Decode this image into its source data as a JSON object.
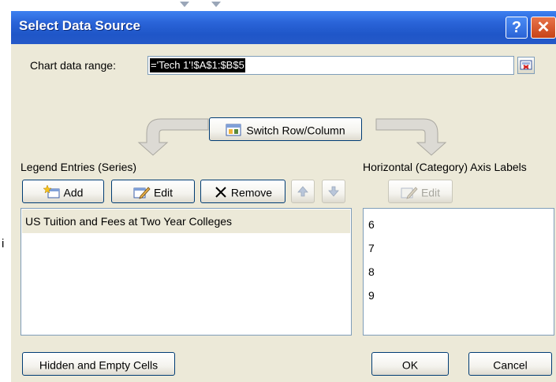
{
  "dialog": {
    "title": "Select Data Source",
    "help_label": "?",
    "close_label": "✕"
  },
  "range": {
    "label": "Chart data range:",
    "value": "='Tech 1'!$A$1:$B$5"
  },
  "switch_button": {
    "label": "Switch Row/Column"
  },
  "legend": {
    "label": "Legend Entries (Series)",
    "add_label": "Add",
    "edit_label": "Edit",
    "remove_label": "Remove",
    "items": [
      "US Tuition and Fees at Two Year Colleges"
    ]
  },
  "axis": {
    "label": "Horizontal (Category) Axis Labels",
    "edit_label": "Edit",
    "items": [
      "6",
      "7",
      "8",
      "9"
    ]
  },
  "bottom": {
    "hidden_label": "Hidden and Empty Cells",
    "ok_label": "OK",
    "cancel_label": "Cancel"
  },
  "background": {
    "mark": "i"
  },
  "colors": {
    "titlebar": "#2a64d8",
    "dialog_bg": "#ece9d8",
    "border": "#003c74"
  }
}
